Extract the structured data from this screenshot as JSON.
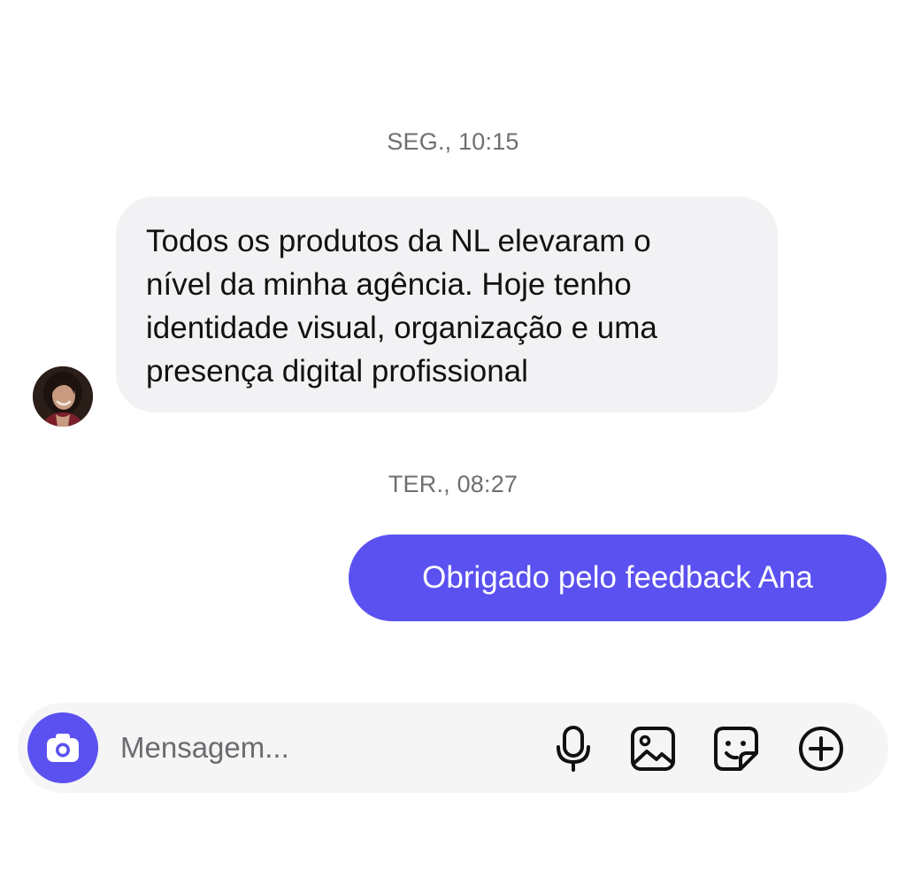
{
  "thread": {
    "timestamps": [
      "SEG., 10:15",
      "TER., 08:27"
    ],
    "incoming": {
      "lines": [
        "Todos os produtos da NL elevaram o",
        "nível da minha agência. Hoje tenho",
        "identidade visual, organização e uma",
        "presença digital profissional"
      ],
      "avatar_icon": "user-photo"
    },
    "outgoing": {
      "text": "Obrigado pelo feedback Ana"
    }
  },
  "composer": {
    "placeholder": "Mensagem...",
    "icons": [
      "camera-icon",
      "microphone-icon",
      "image-icon",
      "sticker-icon",
      "plus-circle-icon"
    ]
  },
  "colors": {
    "accent": "#5b51f0",
    "incoming_bubble": "#f2f2f4",
    "composer_bg": "#f5f5f6",
    "timestamp": "#6f6f73"
  }
}
